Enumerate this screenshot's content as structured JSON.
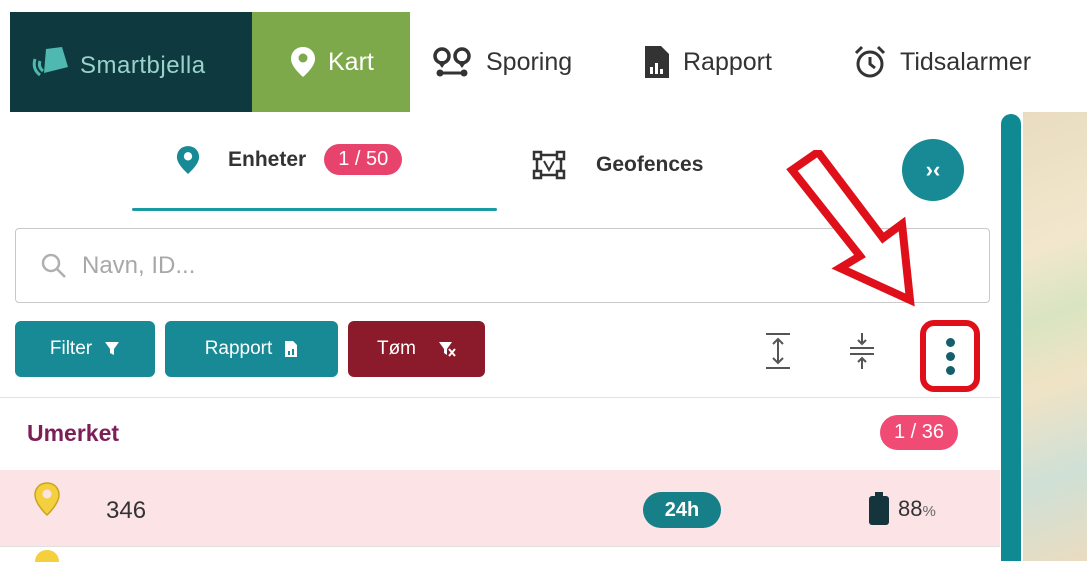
{
  "brand": {
    "name": "Smartbjella",
    "bg_color": "#0e3a3f"
  },
  "nav": {
    "items": [
      {
        "label": "Kart",
        "icon": "map-pin-icon",
        "active": true
      },
      {
        "label": "Sporing",
        "icon": "tracking-icon"
      },
      {
        "label": "Rapport",
        "icon": "report-icon"
      },
      {
        "label": "Tidsalarmer",
        "icon": "alarm-clock-icon"
      }
    ]
  },
  "tabs": {
    "units": {
      "label": "Enheter",
      "count": "1 / 50",
      "active": true
    },
    "geofences": {
      "label": "Geofences"
    }
  },
  "search": {
    "placeholder": "Navn, ID..."
  },
  "toolbar": {
    "filter_label": "Filter",
    "report_label": "Rapport",
    "clear_label": "Tøm"
  },
  "group": {
    "title": "Umerket",
    "count": "1 / 36"
  },
  "item": {
    "id": "346",
    "time_badge": "24h",
    "battery_value": "88",
    "battery_unit": "%"
  },
  "colors": {
    "accent": "#178a95",
    "active_nav": "#7ea94a",
    "danger": "#8b1a2a",
    "badge": "#e8436d",
    "annotation": "#e0101a"
  }
}
